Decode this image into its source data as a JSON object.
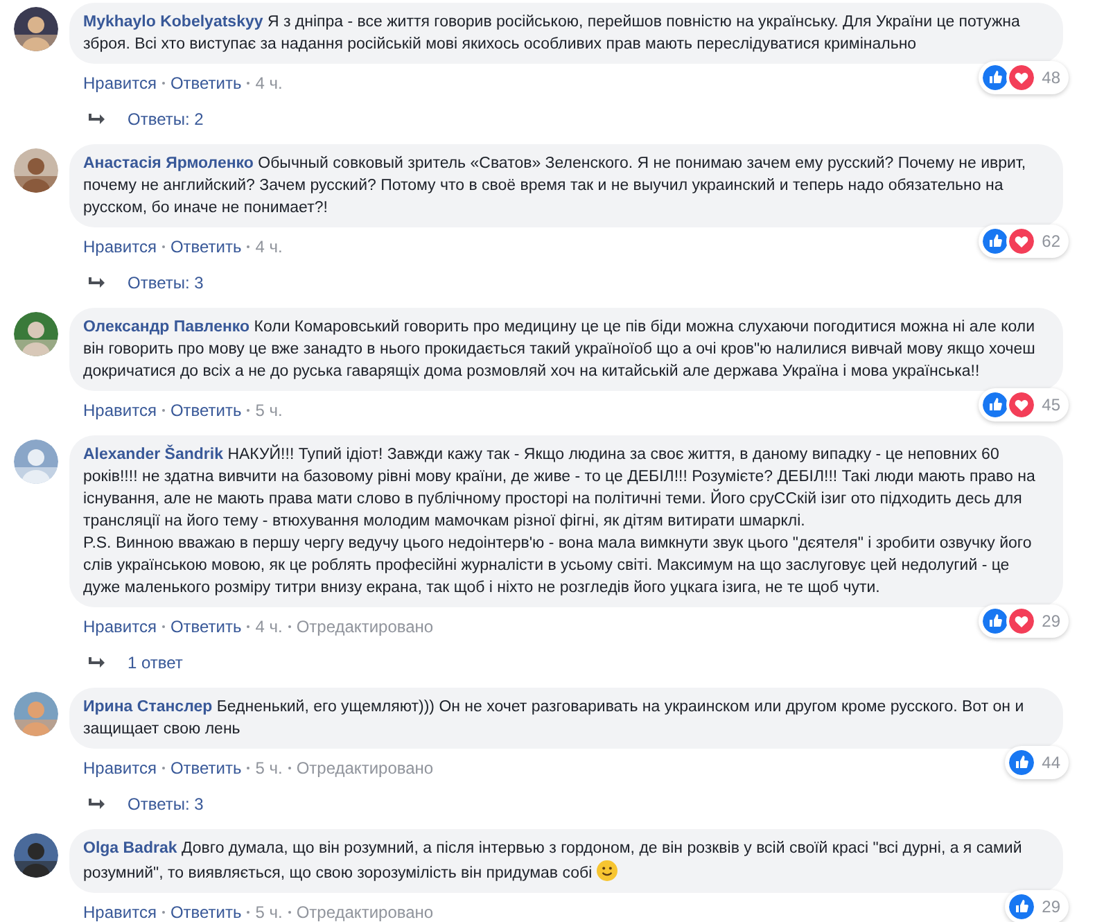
{
  "comments": [
    {
      "author": "Mykhaylo Kobelyatskyy",
      "text": "Я з дніпра - все життя говорив російською, перейшов повністю на українську. Для України це потужна зброя. Всі хто виступає за надання російській мові якихось особливих прав мають переслідуватися кримінально",
      "emoji": false,
      "actions": [
        "Нравится",
        "Ответить"
      ],
      "time": "4 ч.",
      "reactions": [
        {
          "kind": "like"
        },
        {
          "kind": "love"
        }
      ],
      "count": "48",
      "replies": "Ответы: 2"
    },
    {
      "author": "Анастасія Ярмоленко",
      "text": "Обычный совковый зритель «Сватов» Зеленского. Я не понимаю зачем ему русский? Почему не иврит, почему не английский? Зачем русский? Потому что в своё время так и не выучил украинский и теперь надо обязательно на русском, бо иначе не понимает?!",
      "emoji": false,
      "actions": [
        "Нравится",
        "Ответить"
      ],
      "time": "4 ч.",
      "reactions": [
        {
          "kind": "like"
        },
        {
          "kind": "love"
        }
      ],
      "count": "62",
      "replies": "Ответы: 3"
    },
    {
      "author": "Олександр Павленко",
      "text": "Коли Комаровський говорить про медицину це це пів біди можна слухаючи погодитися можна ні але коли він говорить про мову це вже занадто в нього прокидається такий україноїоб що а очі кров\"ю налилися вивчай мову якщо хочеш докричатися до всіх а не до руська гаварящіх дома розмовляй хоч на китайській але держава Україна і мова українська!!",
      "emoji": false,
      "actions": [
        "Нравится",
        "Ответить"
      ],
      "time": "5 ч.",
      "reactions": [
        {
          "kind": "like"
        },
        {
          "kind": "love"
        }
      ],
      "count": "45"
    },
    {
      "author": "Alexander Šandrik",
      "text": "НАКУЙ!!! Тупий ідіот! Завжди кажу так - Якщо людина за своє життя, в даному випадку - це неповних 60 років!!!! не здатна вивчити на базовому рівні мову країни, де живе - то це ДЕБІЛ!!! Розумієте? ДЕБІЛ!!! Такі люди мають право на існування, але не мають права мати слово в публічному просторі на політичні теми. Його сруССкій ізиг ото підходить десь для трансляції на його тему - втюхування молодим мамочкам різної фігні, як дітям витирати шмарклі.\nP.S. Винною вважаю в першу чергу ведучу цього недоінтерв'ю - вона мала вимкнути звук цього \"дєятеля\" і зробити озвучку його слів українською мовою, як це роблять професійні журналісти в усьому світі. Максимум на що заслуговує цей недолугий - це дуже маленького розміру титри внизу екрана, так щоб і ніхто не розгледів його уцкага ізига, не те щоб чути.",
      "emoji": false,
      "actions": [
        "Нравится",
        "Ответить"
      ],
      "time": "4 ч.",
      "edited": "Отредактировано",
      "reactions": [
        {
          "kind": "like"
        },
        {
          "kind": "love"
        }
      ],
      "count": "29",
      "replies": "1 ответ"
    },
    {
      "author": "Ирина Станслер",
      "text": "Бедненький, его ущемляют))) Он не хочет разговаривать на украинском или другом кроме русского. Вот он и защищает свою лень",
      "emoji": false,
      "actions": [
        "Нравится",
        "Ответить"
      ],
      "time": "5 ч.",
      "edited": "Отредактировано",
      "reactions": [
        {
          "kind": "like"
        }
      ],
      "count": "44",
      "replies": "Ответы: 3"
    },
    {
      "author": "Olga Badrak",
      "text": "Довго думала, що він розумний, а після інтервью з гордоном, де він розквів у всій своїй красі \"всі дурні, а я самий розумний\", то виявляється, що свою зорозумілість він придумав собі",
      "emoji": true,
      "actions": [
        "Нравится",
        "Ответить"
      ],
      "time": "5 ч.",
      "edited": "Отредактировано",
      "reactions": [
        {
          "kind": "like"
        }
      ],
      "count": "29"
    }
  ]
}
